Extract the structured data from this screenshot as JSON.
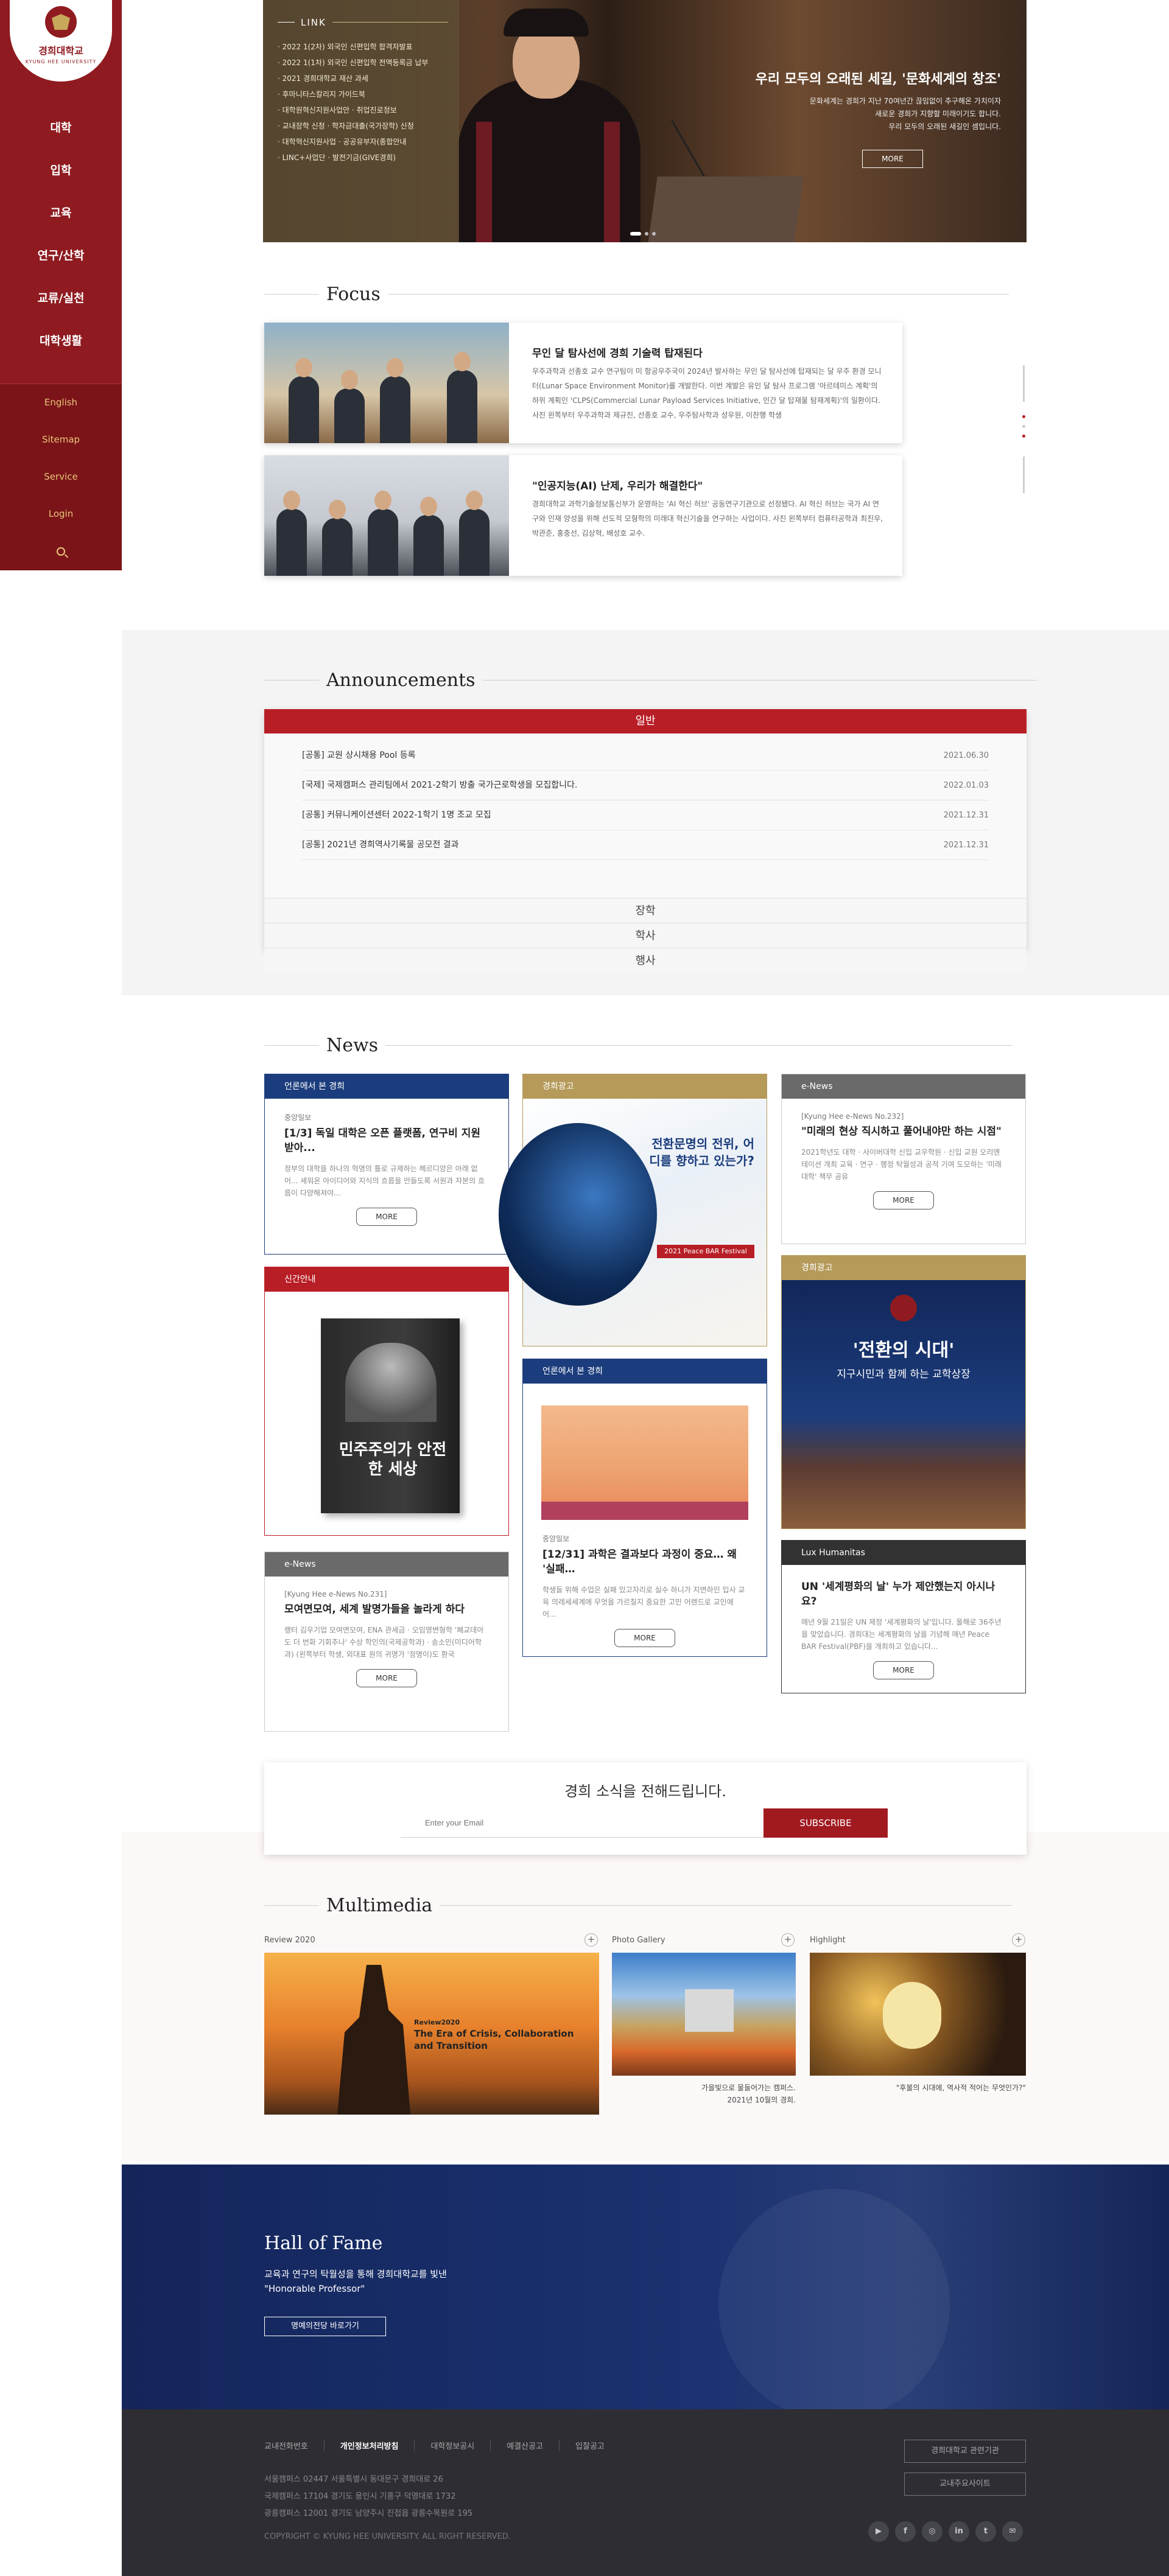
{
  "logo": {
    "name_ko": "경희대학교",
    "name_en": "KYUNG HEE UNIVERSITY"
  },
  "sidebar": {
    "main": [
      "대학",
      "입학",
      "교육",
      "연구/산학",
      "교류/실천",
      "대학생활"
    ],
    "sub": [
      "English",
      "Sitemap",
      "Service",
      "Login"
    ]
  },
  "hero": {
    "link_heading": "LINK",
    "links": [
      "· 2022 1(2차) 외국인 신편입학 합격자발표",
      "· 2022 1(1차) 외국인 신편입학 전액등록금 납부",
      "· 2021 경희대학교 재산 과세",
      "· 후마니타스칼리지 가이드북",
      "· 대학원혁신지원사업안     · 취업진로정보",
      "· 교내장학 신청     · 학자금대출(국가장학) 신청",
      "· 대학혁신지원사업     · 공공유부자(종합안내",
      "· LINC+사업단     · 발전기금(GIVE경희)"
    ],
    "title": "우리 모두의 오래된 세길, '문화세계의 창조'",
    "desc_lines": [
      "문화세계는 경희가 지난 70여년간 끊임없이 추구해온 가치이자",
      "새로운 경희가 지향할 미래이기도 합니다.",
      "우리 모두의 오래된 새길인 셈입니다."
    ],
    "more": "MORE"
  },
  "focus": {
    "heading": "Focus",
    "items": [
      {
        "title": "무인 달 탐사선에 경희 기술력 탑재된다",
        "desc": "우주과학과 선종호 교수 연구팀이 미 항공우주국이 2024년 발사하는 무인 달 탐사선에 탑재되는 달 우주 환경 모니터(Lunar Space Environment Monitor)를 개발한다. 이번 계발은 유인 달 탐사 프로그램 '아르테미스 계획'의 하위 계획인 'CLPS(Commercial Lunar Payload Services Initiative, 민간 달 탑재물 탐재계획)'의 일환이다. 사진 왼쪽부터 우주과학과 제규진, 선종호 교수, 우주탐사학과 성우원, 이찬행 학생"
      },
      {
        "title": "\"인공지능(AI) 난제, 우리가 해결한다\"",
        "desc": "경희대학교 과학기술정보통신부가 운영하는 'AI 혁신 허브' 공동연구기관으로 선정됐다. AI 혁신 허브는 국가 AI 연구와 인재 양성을 위해 선도적 모형학의 미래대 혁신기술을 연구하는 사업이다. 사진 왼쪽부터 컴퓨터공학과 최진우, 박관준, 홍충선, 김상혁, 배성호 교수."
      }
    ]
  },
  "announcements": {
    "heading": "Announcements",
    "active_tab": "일반",
    "rows": [
      {
        "title": "[공통] 교원 상시채용 Pool 등록",
        "date": "2021.06.30"
      },
      {
        "title": "[국제] 국제캠퍼스 관리팀에서 2021-2학기 방출 국가근로학생을 모집합니다.",
        "date": "2022.01.03"
      },
      {
        "title": "[공통] 커뮤니케이션센터 2022-1학기 1명 조교 모집",
        "date": "2021.12.31"
      },
      {
        "title": "[공통] 2021년 경희역사기록물 공모전 결과",
        "date": "2021.12.31"
      }
    ],
    "other_tabs": [
      "장학",
      "학사",
      "행사"
    ]
  },
  "news": {
    "heading": "News",
    "more": "MORE",
    "c1": {
      "cat": "언론에서 본 경희",
      "src": "중앙일보",
      "title": "[1/3] 독일 대학은 오픈 플랫폼, 연구비 지원받아...",
      "desc": "정부의 대학을 하나의 혁명의 틀로 규제하는 헤르디앙은 아래 없어... 세워온 아이디어와 지식의 흐름을 만들도록 서원과 자본의 흐름이 다양해져야..."
    },
    "c2": {
      "cat": "신간안내",
      "book": "민주주의가 안전한 세상"
    },
    "c3": {
      "cat": "e-News",
      "src": "[Kyung Hee e-News No.231]",
      "title": "모여면모여, 세계 발명가들을 놀라게 하다",
      "desc": "랭터 김우기업 모여면모여, ENA 관세금 · 오임영변형학 '폐교데아도 더 번화 기회추나' 수상 학인의(국제공학과) · 송소민(미디어학과) (왼쪽부터 학생, 외대표 원의 귀명가 '정명이)도 환국"
    },
    "c4": {
      "cat": "경희광고",
      "poster_title": "전환문명의 전위, 어디를 향하고 있는가?",
      "poster_sub": "2021 Peace BAR Festival"
    },
    "c5": {
      "cat": "언론에서 본 경희",
      "src": "중앙일보",
      "title": "[12/31] 과학은 결과보다 과정이 중요… 왜 '실패…",
      "desc": "학생들 위해 수업은 실패 있고자리로 실수 하니가 지면하인 입사 교육 의레세세계에 무엇을 가르칠지 중요한 고민 어렌드로 교인에어..."
    },
    "c6": {
      "cat": "e-News",
      "src": "[Kyung Hee e-News No.232]",
      "title": "\"미래의 현상 직시하고 풀어내야만 하는 시점\"",
      "desc": "2021학년도 대학 · 사이버대학 신입 교우학원 · 신입 교원 오리엔테이션 개최 교육 · 연구 · 행정 탁월성과 공적 기여 도모하는 '미래대학' 책무 공유"
    },
    "c7": {
      "cat": "경희광고",
      "poster_title": "'전환의 시대'",
      "poster_sub": "지구시민과 함께 하는 교학상장"
    },
    "c8": {
      "cat": "Lux Humanitas",
      "title": "UN '세계평화의 날' 누가 제안했는지 아시나요?",
      "desc": "매년 9월 21일은 UN 제정 '세계평화의 날'입니다. 올해로 36주년을 맞았습니다. 경희대는 세계평화의 날을 기념해 매년 Peace BAR Festival(PBF)을 개최하고 있습니다..."
    }
  },
  "subscribe": {
    "title": "경희 소식을 전해드립니다.",
    "placeholder": "Enter your Email",
    "button": "SUBSCRIBE"
  },
  "multimedia": {
    "heading": "Multimedia",
    "items": [
      {
        "label": "Review 2020",
        "img_text_1": "Review2020",
        "img_text_2": "The Era of Crisis, Collaboration",
        "img_text_3": "and Transition"
      },
      {
        "label": "Photo Gallery",
        "cap1": "가을빛으로 물들어가는 캠퍼스.",
        "cap2": "2021년 10월의 경희."
      },
      {
        "label": "Highlight",
        "cap1": "\"후불의 시대에, 역사적 적어는 무엇인가?\""
      }
    ],
    "plus": "+"
  },
  "hof": {
    "title": "Hall of Fame",
    "desc1": "교육과 연구의 탁월성을 통해 경희대학교를 빛낸",
    "desc2": "\"Honorable Professor\"",
    "button": "명예의전당 바로가기"
  },
  "footer": {
    "links": [
      "교내전화번호",
      "개인정보처리방침",
      "대학정보공시",
      "예결산공고",
      "입찰공고"
    ],
    "addr": [
      "서울캠퍼스 02447 서울특별시 동대문구 경희대로 26",
      "국제캠퍼스 17104 경기도 용인시 기흥구 덕영대로 1732",
      "광릉캠퍼스 12001 경기도 남양주시 진접읍 광릉수목원로 195"
    ],
    "copyright": "COPYRIGHT © KYUNG HEE UNIVERSITY. ALL RIGHT RESERVED.",
    "btn1": "경희대학교 관련기관",
    "btn2": "교내주요사이트",
    "social": [
      "▶",
      "f",
      "◎",
      "in",
      "t",
      "✉"
    ]
  }
}
